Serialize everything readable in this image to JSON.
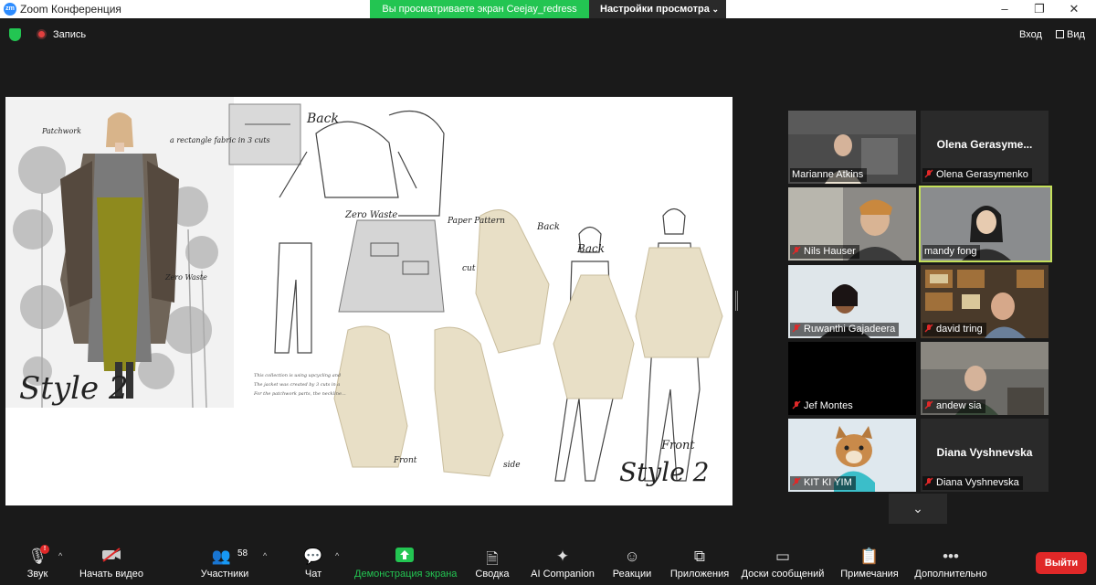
{
  "window": {
    "title": "Zoom Конференция",
    "app_icon_text": "zm",
    "share_banner": "Вы просматриваете экран Ceejay_redress",
    "view_settings": "Настройки просмотра"
  },
  "topbar": {
    "recording_label": "Запись",
    "enter_label": "Вход",
    "view_label": "Вид"
  },
  "shared_content": {
    "handwritten": [
      "Style 2",
      "Back",
      "Zero Waste",
      "Paper Pattern",
      "cut",
      "Back",
      "Back",
      "Front",
      "Style 2",
      "Front",
      "side",
      "Patchwork",
      "a rectangle fabric in 3 cuts",
      "Zero Waste"
    ],
    "caption_lines": [
      "This collection is using upcycling and",
      "The jacket was created by 3 cuts in a",
      "For the patchwork parts, the neckline..."
    ]
  },
  "participants": [
    {
      "name": "Marianne Atkins",
      "video": true,
      "muted": false
    },
    {
      "name": "Olena Gerasymenko",
      "display": "Olena  Gerasyme...",
      "video": false,
      "muted": true
    },
    {
      "name": "Nils Hauser",
      "video": true,
      "muted": true
    },
    {
      "name": "mandy fong",
      "video": true,
      "muted": false,
      "active": true
    },
    {
      "name": "Ruwanthi Gajadeera",
      "video": true,
      "muted": true
    },
    {
      "name": "david tring",
      "video": true,
      "muted": true
    },
    {
      "name": "Jef Montes",
      "video": false,
      "muted": true
    },
    {
      "name": "andew sia",
      "video": true,
      "muted": true
    },
    {
      "name": "KIT KI YIM",
      "video": true,
      "muted": true
    },
    {
      "name": "Diana Vyshnevska",
      "display": "Diana Vyshnevska",
      "video": false,
      "muted": true
    }
  ],
  "toolbar": {
    "audio": "Звук",
    "video": "Начать видео",
    "participants": "Участники",
    "participants_count": "58",
    "chat": "Чат",
    "share": "Демонстрация экрана",
    "summary": "Сводка",
    "ai": "AI Companion",
    "reactions": "Реакции",
    "apps": "Приложения",
    "whiteboards": "Доски сообщений",
    "notes": "Примечания",
    "more": "Дополнительно",
    "leave": "Выйти",
    "audio_badge": "!"
  },
  "colors": {
    "share_green": "#23c552",
    "leave_red": "#e02828",
    "active_speaker": "#c4e05a",
    "background": "#1a1a1a"
  }
}
